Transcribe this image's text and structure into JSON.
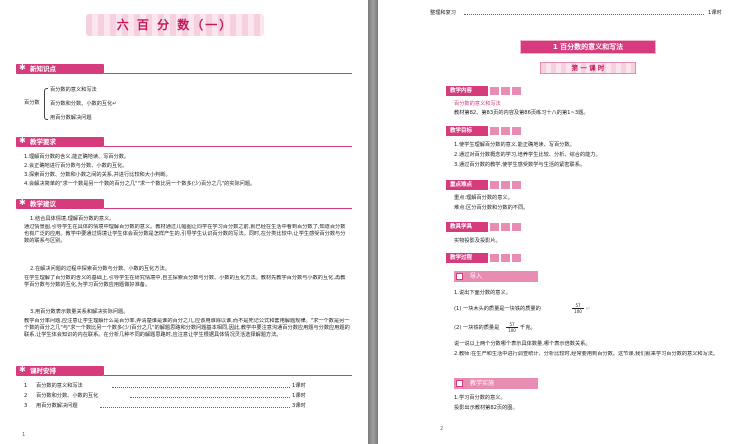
{
  "left": {
    "title": "六 百 分 数（一）",
    "sections": {
      "knowledge": "新知识点",
      "requirements": "教学要求",
      "suggestions": "教学建议",
      "schedule": "课时安排"
    },
    "tree_root": "百分数",
    "tree_items": [
      "百分数的意义和写法",
      "百分数和分数、小数的互化↵",
      "用百分数解决问题"
    ],
    "requirements": [
      "1.理解百分数的含义,能正确地读、写百分数。",
      "2.会正确地进行百分数与分数、小数的互化。",
      "3.探索百分数、分数和小数之间的关系,并进行比较和大小判断。",
      "4.会解决简单的\"求一个数是另一个数的百分之几\"\"求一个数比另一个数多(少)百分之几\"的实际问题。"
    ],
    "suggestions_p1_head": "1.结合具体情境,理解百分数的意义。",
    "suggestions_p1": "通过情景图,引导学生在具体的情境中理解百分数的意义。教材通过几幅图让同学在学习百分数之前,就已经在生活中看到百分数了,知道百分数也有广泛的应用。教学中要通过情境让学生体会百分数是怎样产生的,引导学生认识百分数的写法。同时,在分类比较中,让学生感受百分数与分数的联系与区别。",
    "suggestions_p2_head": "2.在解决问题的过程中探索百分数与分数、小数的互化方法。",
    "suggestions_p2": "在学生理解了百分数的含义的基础上,引导学生在研究情境中,自主探索百分数与分数、小数的互化方法。教材先教学百分数与小数的互化,再教学百分数与分数的互化,为学习百分数应用题做好准备。",
    "suggestions_p3_head": "3.用百分数表示数量关系和解决实际问题。",
    "suggestions_p3": "教学百分率问题,应注意让学生理解什么是百分率,弄清楚谁是谁的百分之几,应该用谁除以谁,而不是死记公式和套用解题规律。\"求一个数是另一个数的百分之几\"与\"求一个数比另一个数多(少)百分之几\"的解题思路和分数问题基本相同,因此,教学中要注意沟通百分数应用题与分数应用题的联系,让学生体会知识的内在联系。在分析几种不同的解题思路时,应注意让学生根据具体情况灵活选择解题方法。",
    "schedule": [
      {
        "n": "1",
        "name": "百分数的意义和写法",
        "hours": "1课时"
      },
      {
        "n": "2",
        "name": "百分数和分数、小数的互化",
        "hours": "1课时"
      },
      {
        "n": "3",
        "name": "用百分数解决问题",
        "hours": "3课时"
      }
    ],
    "page_number": "1"
  },
  "right": {
    "top_line_label": "整理和复习",
    "top_line_hours": "1课时",
    "unit_title": "1 百分数的意义和写法",
    "lesson": "第 一 课 时",
    "boxes": {
      "content": "教学内容",
      "goals": "教学目标",
      "keypoints": "重点难点",
      "tools": "教具学具",
      "process": "教学过程"
    },
    "content_title": "百分数的意义和写法",
    "content_text": "教材第82、第83页的内容及第86页练习十八的第1~3题。",
    "goals": [
      "1.使学生理解百分数的意义,能正确地读、写百分数。",
      "2.通过对百分数概念的学习,培养学生比较、分析、综合的能力。",
      "3.通过百分数的教学,使学生感受数学与生活的紧密联系。"
    ],
    "key": "重点:理解百分数的意义。",
    "difficult": "难点:区分百分数和分数的不同。",
    "tools_text": "实物投影及投影片。",
    "intro_label": "导入",
    "q1": "1.说出下面分数的意义。",
    "q1a": "(1) 一块木头的质量是一块铁的质量的",
    "q1a_frac": [
      "57",
      "100"
    ],
    "q1b": "(2) 一块铁的质量是",
    "q1b_frac": [
      "57",
      "100"
    ],
    "q1b_tail": "千克。",
    "q1_note": "说一说以上两个分数哪个表示具体数量,哪个表示倍数关系。",
    "q2": "2.教师:在生产和生活中进行调查统计、分析比较时,经常要用到百分数。这节课,我们就来学习百分数的意义和写法。",
    "explore_label": "教学实施",
    "explore_text": "1.学习百分数的意义。",
    "explore_text2": "投影出示教材第82页的图。",
    "page_number": "2"
  },
  "colors": {
    "accent": "#d63b7e",
    "light_pink": "#e88cb4",
    "background": "#8c8c8c"
  }
}
